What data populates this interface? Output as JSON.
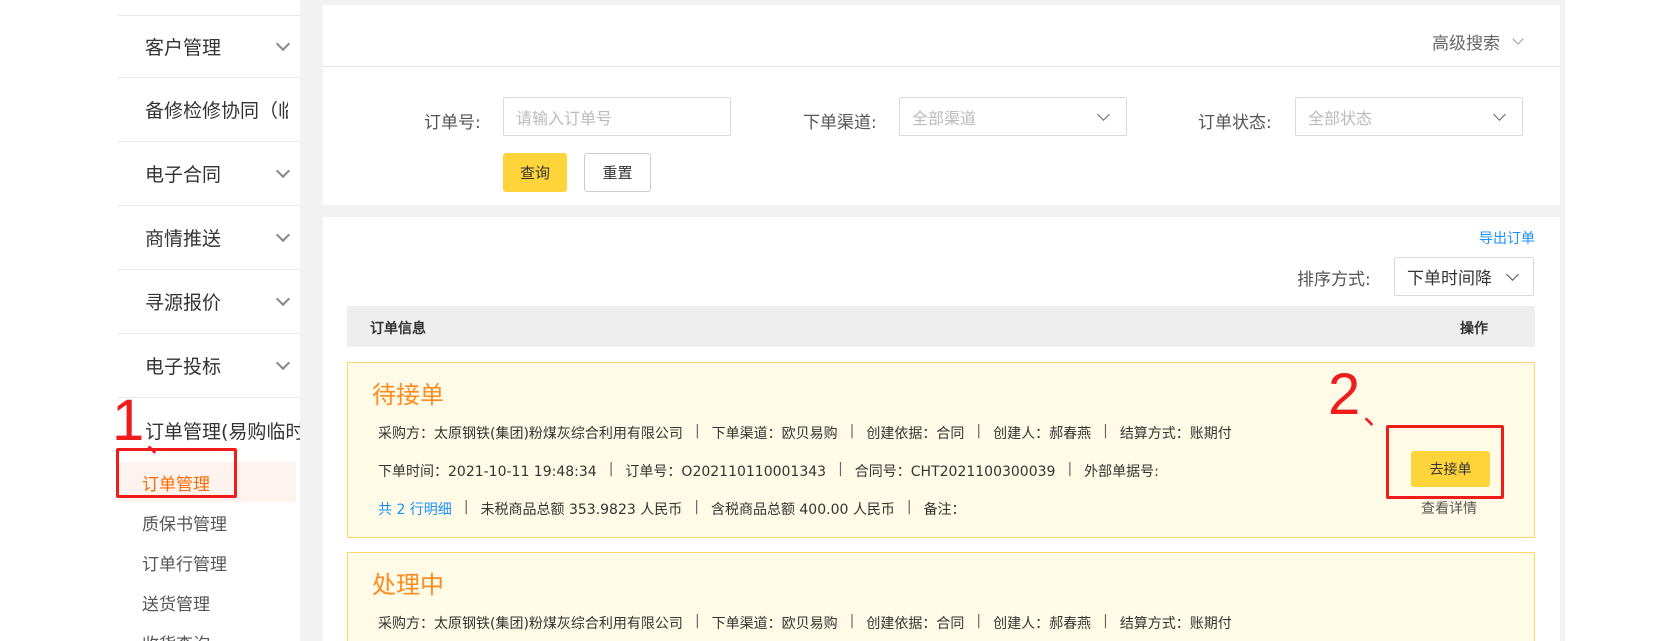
{
  "sidebar": {
    "groups": [
      {
        "label": "客户管理"
      },
      {
        "label": "备修检修协同（临"
      },
      {
        "label": "电子合同"
      },
      {
        "label": "商情推送"
      },
      {
        "label": "寻源报价"
      },
      {
        "label": "电子投标"
      }
    ],
    "open_group": "订单管理(易购临时",
    "sub_items": [
      {
        "label": "订单管理",
        "active": true
      },
      {
        "label": "质保书管理"
      },
      {
        "label": "订单行管理"
      },
      {
        "label": "送货管理"
      },
      {
        "label": "收货查询"
      }
    ]
  },
  "header": {
    "advanced_search": "高级搜索"
  },
  "filters": {
    "order_no_label": "订单号:",
    "order_no_placeholder": "请输入订单号",
    "channel_label": "下单渠道:",
    "channel_value": "全部渠道",
    "status_label": "订单状态:",
    "status_value": "全部状态",
    "query_button": "查询",
    "reset_button": "重置"
  },
  "toolbar": {
    "export_link": "导出订单",
    "sort_label": "排序方式:",
    "sort_value": "下单时间降"
  },
  "table": {
    "col_info": "订单信息",
    "col_action": "操作"
  },
  "orders": [
    {
      "status": "待接单",
      "buyer": "采购方：太原钢铁(集团)粉煤灰综合利用有限公司",
      "channel": "下单渠道：欧贝易购",
      "basis": "创建依据：合同",
      "creator": "创建人：郝春燕",
      "settlement": "结算方式：账期付",
      "order_time": "下单时间：2021-10-11 19:48:34",
      "order_no": "订单号：O202110110001343",
      "contract_no": "合同号：CHT2021100300039",
      "external_no": "外部单据号:",
      "line_detail": "共 2 行明细",
      "untaxed_total": "未税商品总额 353.9823 人民币",
      "taxed_total": "含税商品总额 400.00 人民币",
      "remark": "备注：",
      "accept_button": "去接单",
      "detail_link": "查看详情"
    },
    {
      "status": "处理中",
      "buyer": "采购方：太原钢铁(集团)粉煤灰综合利用有限公司",
      "channel": "下单渠道：欧贝易购",
      "basis": "创建依据：合同",
      "creator": "创建人：郝春燕",
      "settlement": "结算方式：账期付"
    }
  ],
  "annotations": {
    "step1": "1",
    "step2": "2",
    "tick": "、"
  },
  "colors": {
    "accent_yellow": "#ffd43b",
    "status_orange": "#ff8a1f",
    "annotation_red": "#f01c1c",
    "link_blue": "#1890ff"
  }
}
